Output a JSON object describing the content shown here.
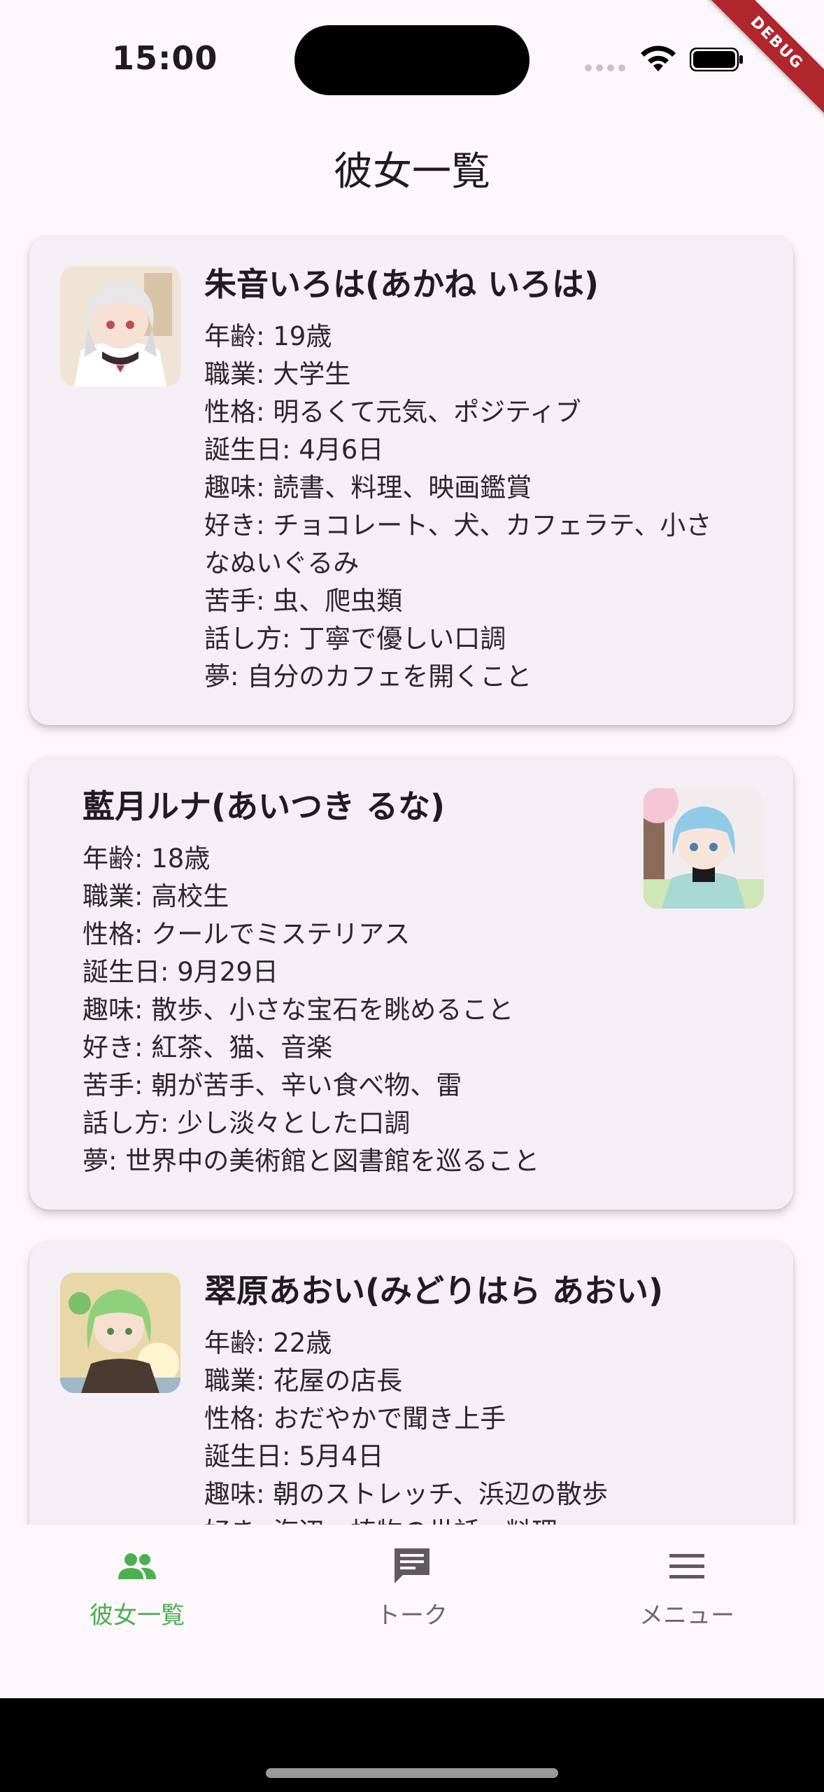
{
  "status": {
    "time": "15:00",
    "debug_label": "DEBUG"
  },
  "header": {
    "title": "彼女一覧"
  },
  "characters": [
    {
      "name": "朱音いろは(あかね いろは)",
      "hair_color": "#e9e6ea",
      "fields": [
        {
          "key": "年齢",
          "value": "19歳"
        },
        {
          "key": "職業",
          "value": "大学生"
        },
        {
          "key": "性格",
          "value": "明るくて元気、ポジティブ"
        },
        {
          "key": "誕生日",
          "value": "4月6日"
        },
        {
          "key": "趣味",
          "value": "読書、料理、映画鑑賞"
        },
        {
          "key": "好き",
          "value": "チョコレート、犬、カフェラテ、小さ"
        },
        {
          "key": "",
          "value": "なぬいぐるみ"
        },
        {
          "key": "苦手",
          "value": "虫、爬虫類"
        },
        {
          "key": "話し方",
          "value": "丁寧で優しい口調"
        },
        {
          "key": "夢",
          "value": "自分のカフェを開くこと"
        }
      ]
    },
    {
      "name": "藍月ルナ(あいつき るな)",
      "hair_color": "#8fcbe8",
      "fields": [
        {
          "key": "年齢",
          "value": "18歳"
        },
        {
          "key": "職業",
          "value": "高校生"
        },
        {
          "key": "性格",
          "value": "クールでミステリアス"
        },
        {
          "key": "誕生日",
          "value": "9月29日"
        },
        {
          "key": "趣味",
          "value": "散歩、小さな宝石を眺めること"
        },
        {
          "key": "好き",
          "value": "紅茶、猫、音楽"
        },
        {
          "key": "苦手",
          "value": "朝が苦手、辛い食べ物、雷"
        },
        {
          "key": "話し方",
          "value": "少し淡々とした口調"
        },
        {
          "key": "夢",
          "value": "世界中の美術館と図書館を巡ること"
        }
      ]
    },
    {
      "name": "翠原あおい(みどりはら あおい)",
      "hair_color": "#8fd07a",
      "fields": [
        {
          "key": "年齢",
          "value": "22歳"
        },
        {
          "key": "職業",
          "value": "花屋の店長"
        },
        {
          "key": "性格",
          "value": "おだやかで聞き上手"
        },
        {
          "key": "誕生日",
          "value": "5月4日"
        },
        {
          "key": "趣味",
          "value": "朝のストレッチ、浜辺の散歩"
        },
        {
          "key": "好き",
          "value": "海辺、植物の世話、料理"
        }
      ]
    }
  ],
  "bottom_nav": {
    "items": [
      {
        "label": "彼女一覧",
        "icon": "people-icon",
        "active": true
      },
      {
        "label": "トーク",
        "icon": "chat-icon",
        "active": false
      },
      {
        "label": "メニュー",
        "icon": "menu-icon",
        "active": false
      }
    ]
  },
  "colors": {
    "accent": "#4caf50",
    "background": "#fdf7fc",
    "card": "#f4eff4"
  }
}
